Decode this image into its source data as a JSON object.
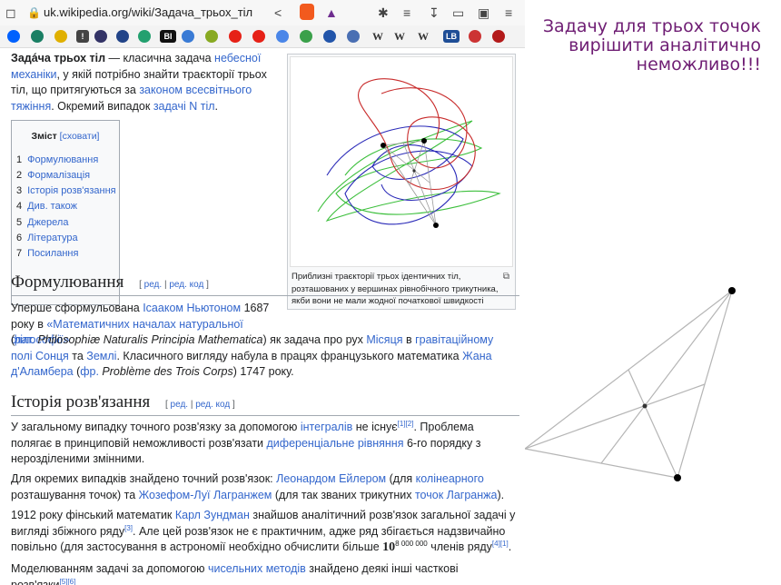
{
  "browser": {
    "url": "uk.wikipedia.org/wiki/Задача_трьох_тіл"
  },
  "bookmarks": [
    {
      "icon": "dropbox-icon",
      "color": "#0061fe"
    },
    {
      "icon": "bookmark-icon",
      "color": "#1a7f64"
    },
    {
      "icon": "clock-icon",
      "color": "#e0b000"
    },
    {
      "icon": "exclamation-icon",
      "color": "#444444",
      "label": "!"
    },
    {
      "icon": "globe-icon",
      "color": "#333366"
    },
    {
      "icon": "compass-icon",
      "color": "#224488"
    },
    {
      "icon": "r-icon",
      "color": "#23a06f"
    },
    {
      "icon": "bi-icon",
      "color": "#111111",
      "label": "BI"
    },
    {
      "icon": "diamond-icon",
      "color": "#3a7bd5"
    },
    {
      "icon": "puzzle-icon",
      "color": "#88aa22"
    },
    {
      "icon": "youtube-icon",
      "color": "#e62117"
    },
    {
      "icon": "youtube-icon",
      "color": "#e62117"
    },
    {
      "icon": "translate-icon",
      "color": "#4a86e8"
    },
    {
      "icon": "leaf-icon",
      "color": "#3aa04a"
    },
    {
      "icon": "refresh-icon",
      "color": "#2255aa"
    },
    {
      "icon": "scholar-icon",
      "color": "#4a6fb3"
    },
    {
      "icon": "wikipedia-icon",
      "label": "W"
    },
    {
      "icon": "wikipedia-icon",
      "label": "W"
    },
    {
      "icon": "wikipedia-icon",
      "label": "W"
    },
    {
      "icon": "lb-icon",
      "color": "#1f4e96",
      "label": "LB"
    },
    {
      "icon": "thermometer-icon",
      "color": "#cc3333"
    },
    {
      "icon": "ublock-icon",
      "color": "#b31a1a"
    }
  ],
  "article": {
    "intro": {
      "bold": "Задáча трьох тіл",
      "t1": " — класична задача ",
      "l1": "небесної механіки",
      "t2": ", у якій потрібно знайти траєкторії трьох тіл, що притягуються за ",
      "l2": "законом всесвітнього тяжіння",
      "t3": ". Окремий випадок ",
      "l3": "задачі N тіл",
      "t4": "."
    },
    "toc": {
      "title": "Зміст",
      "hide": "[сховати]",
      "items": [
        {
          "n": "1",
          "label": "Формулювання"
        },
        {
          "n": "2",
          "label": "Формалізація"
        },
        {
          "n": "3",
          "label": "Історія розв'язання"
        },
        {
          "n": "4",
          "label": "Див. також"
        },
        {
          "n": "5",
          "label": "Джерела"
        },
        {
          "n": "6",
          "label": "Література"
        },
        {
          "n": "7",
          "label": "Посилання"
        }
      ]
    },
    "figure": {
      "caption": "Приблизні траєкторії трьох ідентичних тіл, розташованих у вершинах рівнобічного трикутника, якби вони не мали жодної початкової швидкості"
    },
    "section1": {
      "title": "Формулювання",
      "edit1": "ред.",
      "edit2": "ред. код",
      "t1": "Уперше сформульована ",
      "l1": "Ісааком Ньютоном",
      "t2": " 1687 року в ",
      "l2": "«Математичних началах натуральної філософії»",
      "t3": " (",
      "l3": "лат.",
      "i1": " Philosophiæ Naturalis Principia Mathematica",
      "t4": ") як задача про рух ",
      "l4": "Місяця",
      "t5": " в ",
      "l5": "гравітаційному полі Сонця",
      "t6": " та ",
      "l6": "Землі",
      "t7": ". Класичного вигляду набула в працях французького математика ",
      "l7": "Жана д'Аламбера",
      "t8": " (",
      "l8": "фр.",
      "i2": " Problème des Trois Corps",
      "t9": ") 1747 року."
    },
    "section2": {
      "title": "Історія розв'язання",
      "edit1": "ред.",
      "edit2": "ред. код",
      "p1": {
        "t1": "У загальному випадку точного розв'язку за допомогою ",
        "l1": "інтегралів",
        "t2": " не існує",
        "s1": "[1][2]",
        "t3": ". Проблема полягає в принциповій неможливості розв'язати ",
        "l2": "диференціальне рівняння",
        "t4": " 6-го порядку з нерозділеними змінними."
      },
      "p2": {
        "t1": "Для окремих випадків знайдено точний розв'язок: ",
        "l1": "Леонардом Ейлером",
        "t2": " (для ",
        "l2": "колінеарного",
        "t3": " розташування точок) та ",
        "l3": "Жозефом-Луї Лагранжем",
        "t4": " (для так званих трикутних ",
        "l4": "точок Лагранжа",
        "t5": ")."
      },
      "p3": {
        "t1": "1912 року фінський математик ",
        "l1": "Карл Зундман",
        "t2": " знайшов аналітичний розв'язок загальної задачі у вигляді збіжного ряду",
        "s1": "[3]",
        "t3": ". Але цей розв'язок не є практичним, адже ряд збігається надзвичайно повільно (для застосування в астрономії необхідно обчислити більше ",
        "base": "10",
        "exp": "8 000 000",
        "t4": " членів ряду",
        "s2": "[4]",
        "s3": "[1]",
        "t5": "."
      },
      "p4": {
        "t1": "Моделюванням задачі за допомогою ",
        "l1": "чисельних методів",
        "t2": " знайдено деякі інші часткові розв'язки",
        "s1": "[5][6]",
        "t3": "."
      }
    }
  },
  "overlay": {
    "headline": "Задачу для трьох точок вирішити аналітично неможливо!!!",
    "color": "#6e1d73"
  }
}
